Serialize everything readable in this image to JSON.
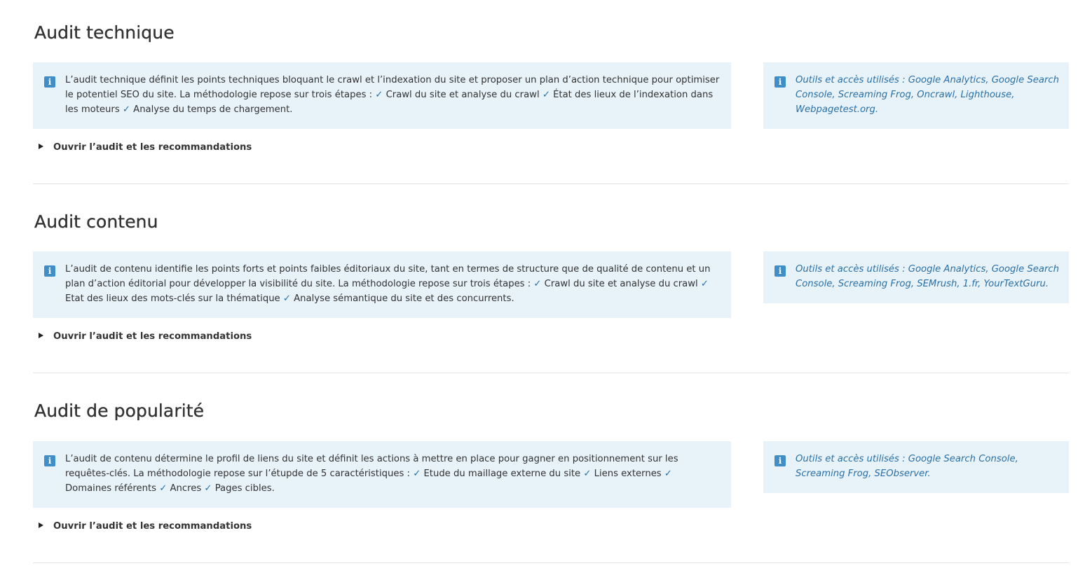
{
  "sections": [
    {
      "title": "Audit technique",
      "description": "L’audit technique définit les points techniques bloquant le crawl et l’indexation du site et proposer un plan d’action technique pour optimiser le potentiel SEO du site. La méthodologie repose sur trois étapes : ",
      "steps": [
        "Crawl du site et analyse du crawl",
        "État des lieux de l’indexation dans les moteurs",
        "Analyse du temps de chargement."
      ],
      "tools": "Outils et accès utilisés : Google Analytics, Google Search Console, Screaming Frog, Oncrawl, Lighthouse, Webpagetest.org.",
      "toggle_label": "Ouvrir l’audit et les recommandations"
    },
    {
      "title": "Audit contenu",
      "description": "L’audit de contenu identifie les points forts et points faibles éditoriaux du site, tant en termes de structure que de qualité de contenu et  un plan d’action éditorial pour développer la visibilité du site. La méthodologie repose sur trois étapes : ",
      "steps": [
        "Crawl du site et analyse du crawl",
        "Etat des lieux des mots-clés sur la thématique",
        "Analyse sémantique du site et des concurrents."
      ],
      "tools": "Outils et accès utilisés : Google Analytics, Google Search Console, Screaming Frog, SEMrush, 1.fr, YourTextGuru.",
      "toggle_label": "Ouvrir l’audit et les recommandations"
    },
    {
      "title": "Audit de popularité",
      "description": "L’audit de contenu détermine le profil de liens du site et définit les actions à mettre en place pour gagner en positionnement sur les requêtes-clés. La méthodologie repose sur l’étupde de 5 caractéristiques : ",
      "steps": [
        "Etude du maillage externe du site",
        "Liens externes",
        "Domaines référents",
        "Ancres",
        "Pages cibles."
      ],
      "tools": "Outils et accès utilisés : Google Search Console, Screaming Frog, SEObserver.",
      "toggle_label": "Ouvrir l’audit et les recommandations"
    }
  ],
  "check_glyph": "✓",
  "info_glyph": "i",
  "icons": {
    "info": "info-icon",
    "toggle": "triangle-right-icon"
  },
  "colors": {
    "box_bg": "#e7f2f9",
    "accent": "#2a70a6",
    "icon": "#3f8ec8",
    "divider": "#e2e2e2"
  }
}
